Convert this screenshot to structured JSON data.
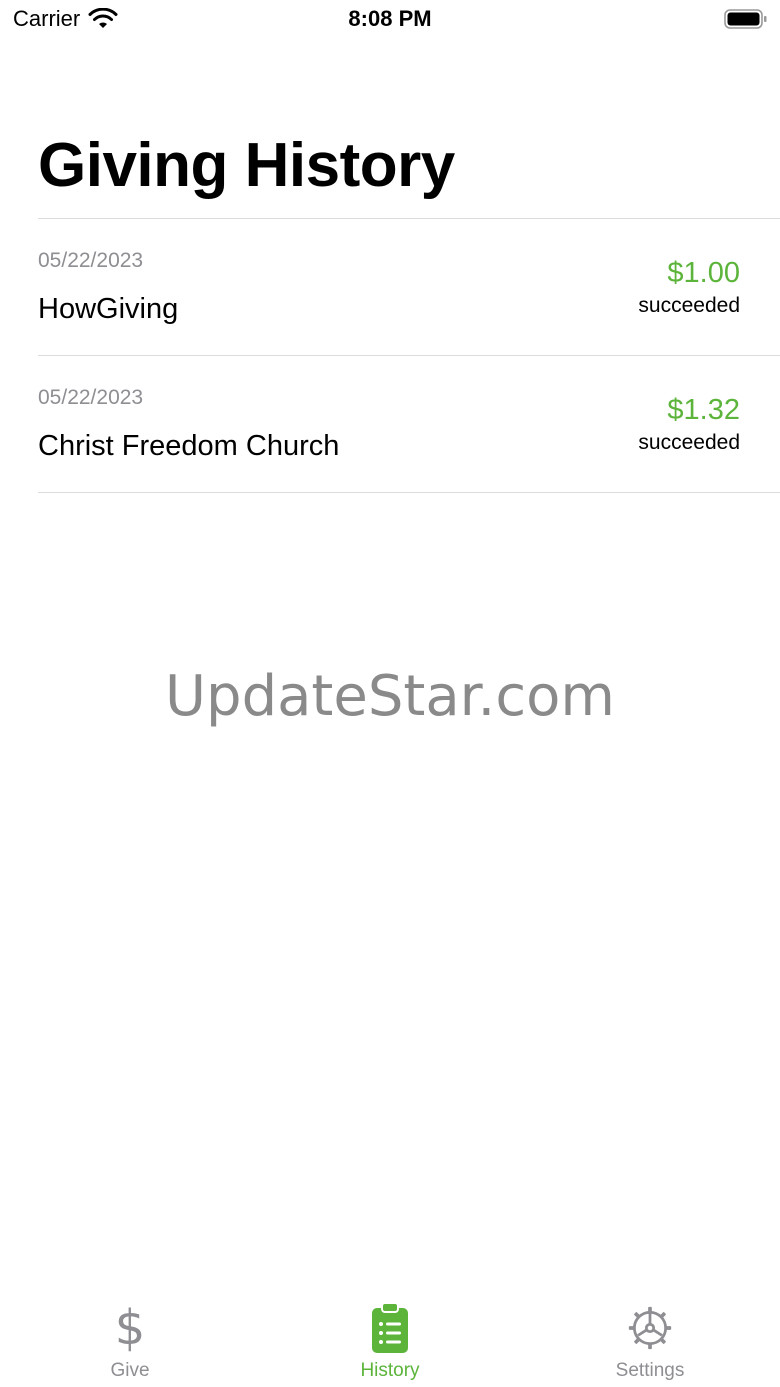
{
  "status_bar": {
    "carrier": "Carrier",
    "time": "8:08 PM",
    "icons": [
      "wifi-icon",
      "battery-icon"
    ]
  },
  "page": {
    "title": "Giving History"
  },
  "history": [
    {
      "date": "05/22/2023",
      "name": "HowGiving",
      "amount": "$1.00",
      "status": "succeeded"
    },
    {
      "date": "05/22/2023",
      "name": "Christ Freedom Church",
      "amount": "$1.32",
      "status": "succeeded"
    }
  ],
  "watermark": "UpdateStar.com",
  "tab_bar": {
    "tabs": [
      {
        "label": "Give",
        "icon": "dollar-icon",
        "active": false
      },
      {
        "label": "History",
        "icon": "clipboard-list-icon",
        "active": true
      },
      {
        "label": "Settings",
        "icon": "gear-icon",
        "active": false
      }
    ]
  },
  "colors": {
    "accent": "#5cb43b",
    "inactive": "#8e8e93",
    "separator": "#dcdcdc",
    "secondary_text": "#8e8e93"
  }
}
